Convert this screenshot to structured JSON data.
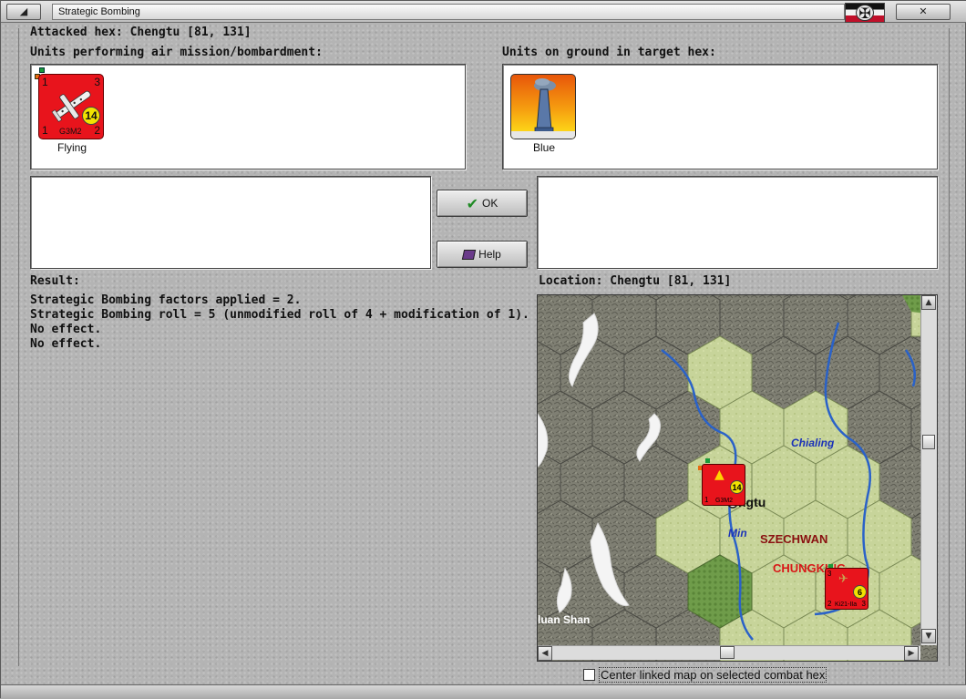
{
  "window": {
    "title": "Strategic Bombing",
    "minimize_glyph": "◢",
    "close_glyph": "✕",
    "flag_icon": "nationality-flag-icon",
    "flag_glyph": "✠"
  },
  "attacked_hex": "Attacked hex: Chengtu  [81, 131]",
  "air_units_heading": "Units performing air mission/bombardment:",
  "ground_units_heading": "Units on ground in target hex:",
  "air_units": [
    {
      "name": "G3M2",
      "caption": "Flying",
      "top_left": "1",
      "top_right": "3",
      "bottom_left": "1",
      "bottom_right": "2",
      "strength": "14",
      "color": "#e8141c"
    }
  ],
  "ground_units": [
    {
      "caption": "Blue",
      "icon": "factory-smokestack-icon"
    }
  ],
  "buttons": {
    "ok": "OK",
    "ok_icon": "checkmark-icon",
    "help": "Help",
    "help_icon": "book-icon"
  },
  "result": {
    "heading": "Result:",
    "lines": [
      "Strategic Bombing factors applied = 2.",
      "Strategic Bombing roll = 5 (unmodified roll of 4 + modification of 1).",
      "No effect.",
      "No effect."
    ]
  },
  "location": "Location:  Chengtu  [81, 131]",
  "map": {
    "labels": {
      "river_chialing": "Chialing",
      "river_min": "Min",
      "city_chengtu": "ngtu",
      "province": "SZECHWAN",
      "city_chungking": "CHUNGKING",
      "mountains": "luan Shan"
    },
    "units": [
      {
        "name": "G3M2",
        "strength": "14",
        "top_left": "1",
        "bottom_left": "1",
        "bottom_right": "2"
      },
      {
        "name": "Ki21-IIa",
        "strength": "6",
        "top_left": "3",
        "bottom_left": "2",
        "bottom_right": "3"
      }
    ]
  },
  "checkbox": {
    "label": "Center linked map on selected combat hex",
    "checked": false
  },
  "colors": {
    "unit_red": "#e8141c",
    "river_blue": "#2a62c8",
    "city_red": "#d81818",
    "label_darkred": "#8a1010",
    "clear_terrain": "#c7d49a",
    "forest_terrain": "#6f9c4a",
    "mountain_terrain": "#7d7d72"
  }
}
